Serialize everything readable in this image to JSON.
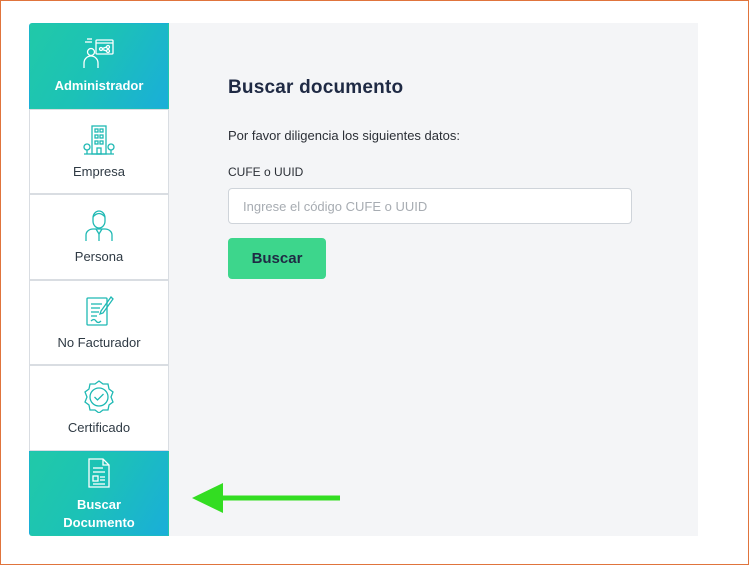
{
  "sidebar": {
    "items": [
      {
        "label": "Administrador",
        "icon": "admin-network-icon",
        "active": true
      },
      {
        "label": "Empresa",
        "icon": "building-icon",
        "active": false
      },
      {
        "label": "Persona",
        "icon": "person-icon",
        "active": false
      },
      {
        "label": "No Facturador",
        "icon": "document-pen-icon",
        "active": false
      },
      {
        "label": "Certificado",
        "icon": "certificate-badge-icon",
        "active": false
      },
      {
        "label": "Buscar Documento",
        "icon": "search-document-icon",
        "active": true
      }
    ]
  },
  "main": {
    "title": "Buscar documento",
    "subtitle": "Por favor diligencia los siguientes datos:",
    "field_label": "CUFE o UUID",
    "field_placeholder": "Ingrese el código CUFE o UUID",
    "field_value": "",
    "button_label": "Buscar"
  },
  "colors": {
    "accent_gradient_start": "#21c9a8",
    "accent_gradient_end": "#1aaed9",
    "button": "#3dd68c",
    "annotation_arrow": "#33dd22",
    "frame_border": "#e0743c"
  }
}
